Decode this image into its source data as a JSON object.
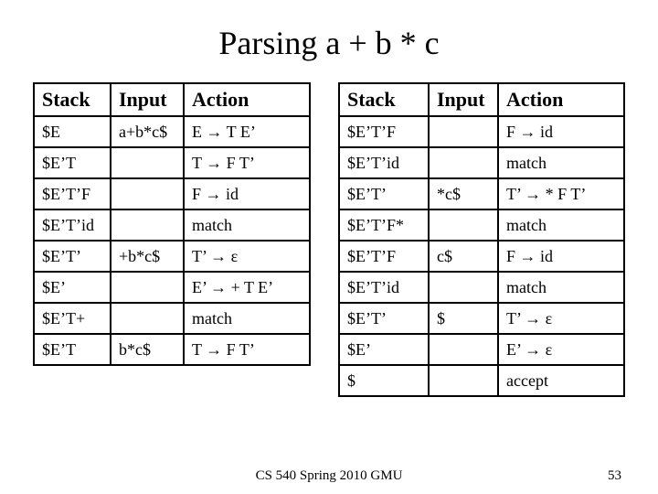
{
  "title": "Parsing a + b * c",
  "headers": {
    "stack": "Stack",
    "input": "Input",
    "action": "Action"
  },
  "left": [
    {
      "stack": "$E",
      "input": "a+b*c$",
      "action": "E → T E’"
    },
    {
      "stack": "$E’T",
      "input": "",
      "action": "T → F T’"
    },
    {
      "stack": "$E’T’F",
      "input": "",
      "action": "F → id"
    },
    {
      "stack": "$E’T’id",
      "input": "",
      "action": "match"
    },
    {
      "stack": "$E’T’",
      "input": "+b*c$",
      "action": "T’ → ε"
    },
    {
      "stack": "$E’",
      "input": "",
      "action": "E’ → + T E’"
    },
    {
      "stack": "$E’T+",
      "input": "",
      "action": "match"
    },
    {
      "stack": "$E’T",
      "input": "b*c$",
      "action": "T → F T’"
    }
  ],
  "right": [
    {
      "stack": "$E’T’F",
      "input": "",
      "action": "F → id"
    },
    {
      "stack": "$E’T’id",
      "input": "",
      "action": "match"
    },
    {
      "stack": "$E’T’",
      "input": "*c$",
      "action": "T’ → * F T’"
    },
    {
      "stack": "$E’T’F*",
      "input": "",
      "action": "match"
    },
    {
      "stack": "$E’T’F",
      "input": "c$",
      "action": "F → id"
    },
    {
      "stack": "$E’T’id",
      "input": "",
      "action": "match"
    },
    {
      "stack": "$E’T’",
      "input": "$",
      "action": "T’ → ε"
    },
    {
      "stack": "$E’",
      "input": "",
      "action": "E’ → ε"
    },
    {
      "stack": "$",
      "input": "",
      "action": "accept"
    }
  ],
  "footer": {
    "text": "CS 540 Spring 2010 GMU",
    "page": "53"
  }
}
